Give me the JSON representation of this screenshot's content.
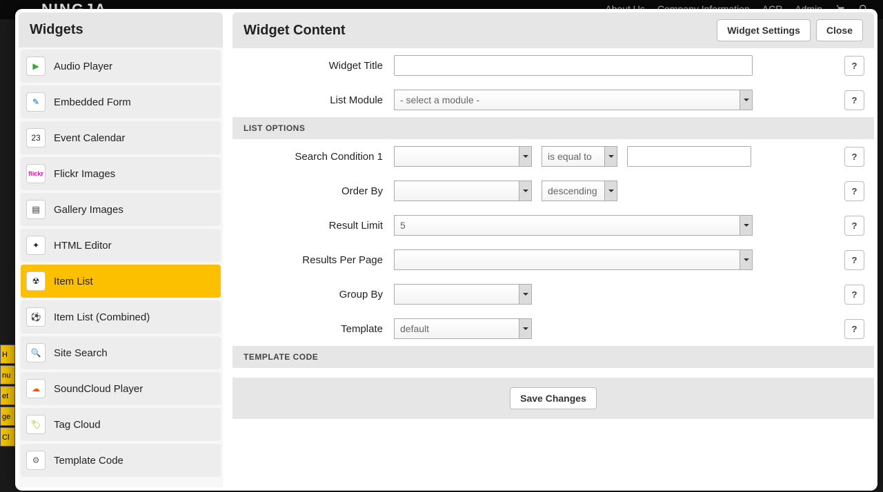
{
  "topbar": {
    "logo": "NINGJA",
    "nav": [
      "About Us",
      "Company Information",
      "ACR",
      "Admin"
    ]
  },
  "sidebar": {
    "title": "Widgets",
    "items": [
      {
        "label": "Audio Player",
        "icon": "▶",
        "iclass": "ic-play",
        "selected": false
      },
      {
        "label": "Embedded Form",
        "icon": "✎",
        "iclass": "ic-form",
        "selected": false
      },
      {
        "label": "Event Calendar",
        "icon": "23",
        "iclass": "ic-cal",
        "selected": false
      },
      {
        "label": "Flickr Images",
        "icon": "flickr",
        "iclass": "ic-flickr",
        "selected": false
      },
      {
        "label": "Gallery Images",
        "icon": "▤",
        "iclass": "ic-gallery",
        "selected": false
      },
      {
        "label": "HTML Editor",
        "icon": "✦",
        "iclass": "ic-html",
        "selected": false
      },
      {
        "label": "Item List",
        "icon": "☢",
        "iclass": "ic-item",
        "selected": true
      },
      {
        "label": "Item List (Combined)",
        "icon": "⚽",
        "iclass": "ic-combined",
        "selected": false
      },
      {
        "label": "Site Search",
        "icon": "🔍",
        "iclass": "ic-search",
        "selected": false
      },
      {
        "label": "SoundCloud Player",
        "icon": "☁",
        "iclass": "ic-sound",
        "selected": false
      },
      {
        "label": "Tag Cloud",
        "icon": "🏷",
        "iclass": "ic-tag",
        "selected": false
      },
      {
        "label": "Template Code",
        "icon": "⚙",
        "iclass": "ic-code",
        "selected": false
      }
    ]
  },
  "content": {
    "title": "Widget Content",
    "settingsBtn": "Widget Settings",
    "closeBtn": "Close",
    "fields": {
      "widgetTitle": {
        "label": "Widget Title",
        "value": ""
      },
      "listModule": {
        "label": "List Module",
        "value": "- select a module -"
      },
      "listOptionsHeader": "LIST OPTIONS",
      "searchCondition": {
        "label": "Search Condition 1",
        "field": "",
        "op": "is equal to",
        "value": ""
      },
      "orderBy": {
        "label": "Order By",
        "field": "",
        "dir": "descending"
      },
      "resultLimit": {
        "label": "Result Limit",
        "value": "5"
      },
      "resultsPerPage": {
        "label": "Results Per Page",
        "value": ""
      },
      "groupBy": {
        "label": "Group By",
        "value": ""
      },
      "template": {
        "label": "Template",
        "value": "default"
      },
      "templateCodeHeader": "TEMPLATE CODE",
      "saveBtn": "Save Changes"
    },
    "help": "?"
  }
}
